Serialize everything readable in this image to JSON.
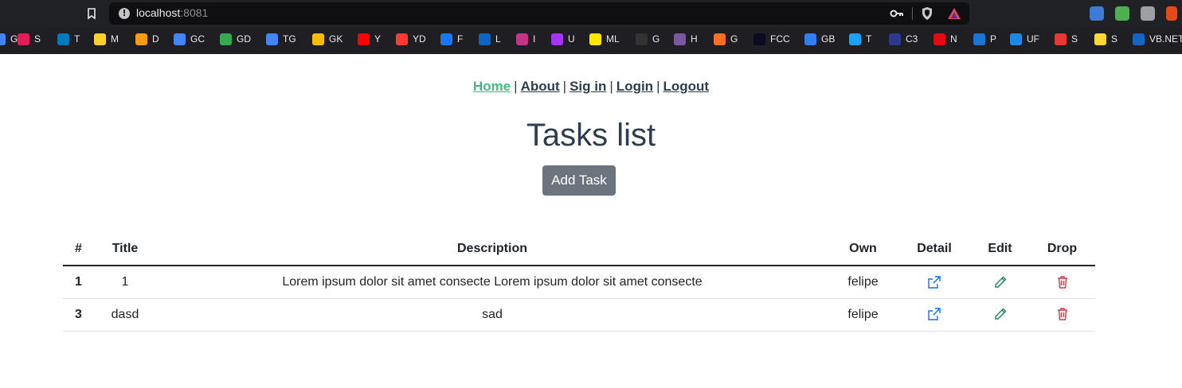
{
  "browser": {
    "url_host": "localhost",
    "url_port": ":8081",
    "bookmarks": [
      {
        "label": "G",
        "icon": "google-icon",
        "color": "#4285f4"
      },
      {
        "label": "S",
        "icon": "slack-icon",
        "color": "#e01e5a"
      },
      {
        "label": "T",
        "icon": "trello-icon",
        "color": "#0079bf"
      },
      {
        "label": "M",
        "icon": "miro-icon",
        "color": "#ffd02f"
      },
      {
        "label": "D",
        "icon": "drive-folder-icon",
        "color": "#f39c12"
      },
      {
        "label": "GC",
        "icon": "google-calendar-icon",
        "color": "#4285f4"
      },
      {
        "label": "GD",
        "icon": "google-drive-icon",
        "color": "#34a853"
      },
      {
        "label": "TG",
        "icon": "google-translate-icon",
        "color": "#4285f4"
      },
      {
        "label": "GK",
        "icon": "google-keep-icon",
        "color": "#fbbc04"
      },
      {
        "label": "Y",
        "icon": "youtube-icon",
        "color": "#ff0000"
      },
      {
        "label": "YD",
        "icon": "yandex-icon",
        "color": "#ff3b30"
      },
      {
        "label": "F",
        "icon": "facebook-icon",
        "color": "#1877f2"
      },
      {
        "label": "L",
        "icon": "linkedin-icon",
        "color": "#0a66c2"
      },
      {
        "label": "I",
        "icon": "instagram-icon",
        "color": "#c13584"
      },
      {
        "label": "U",
        "icon": "udemy-icon",
        "color": "#a435f0"
      },
      {
        "label": "ML",
        "icon": "mercadolibre-icon",
        "color": "#ffe600"
      },
      {
        "label": "G",
        "icon": "github-icon",
        "color": "#333333"
      },
      {
        "label": "H",
        "icon": "heroku-icon",
        "color": "#79589f"
      },
      {
        "label": "G",
        "icon": "gitlab-icon",
        "color": "#fc6d26"
      },
      {
        "label": "FCC",
        "icon": "freecodecamp-icon",
        "color": "#0a0a23"
      },
      {
        "label": "GB",
        "icon": "gb-icon",
        "color": "#2f80ed"
      },
      {
        "label": "T",
        "icon": "twitter-icon",
        "color": "#1da1f2"
      },
      {
        "label": "C3",
        "icon": "c3-icon",
        "color": "#2b3a8c"
      },
      {
        "label": "N",
        "icon": "netflix-icon",
        "color": "#e50914"
      },
      {
        "label": "P",
        "icon": "play-icon",
        "color": "#1976d2"
      },
      {
        "label": "UF",
        "icon": "uf-icon",
        "color": "#1e88e5"
      },
      {
        "label": "S",
        "icon": "s-icon",
        "color": "#e53935"
      },
      {
        "label": "S",
        "icon": "pac-icon",
        "color": "#fdd835"
      },
      {
        "label": "VB.NET",
        "icon": "vbnet-icon",
        "color": "#1565c0"
      }
    ]
  },
  "nav": {
    "home": "Home",
    "about": "About",
    "signin": "Sig in",
    "login": "Login",
    "logout": "Logout",
    "separator": "|"
  },
  "page": {
    "title": "Tasks list",
    "add_button": "Add Task"
  },
  "table": {
    "headers": [
      "#",
      "Title",
      "Description",
      "Own",
      "Detail",
      "Edit",
      "Drop"
    ],
    "rows": [
      {
        "id": "1",
        "title": "1",
        "description": "Lorem ipsum dolor sit amet consecte Lorem ipsum dolor sit amet consecte",
        "own": "felipe"
      },
      {
        "id": "3",
        "title": "dasd",
        "description": "sad",
        "own": "felipe"
      }
    ]
  },
  "colors": {
    "nav_active": "#42b983",
    "text": "#2c3e50",
    "button": "#6c757d",
    "detail_icon": "#0d6efd",
    "edit_icon": "#198754",
    "drop_icon": "#dc3545"
  }
}
